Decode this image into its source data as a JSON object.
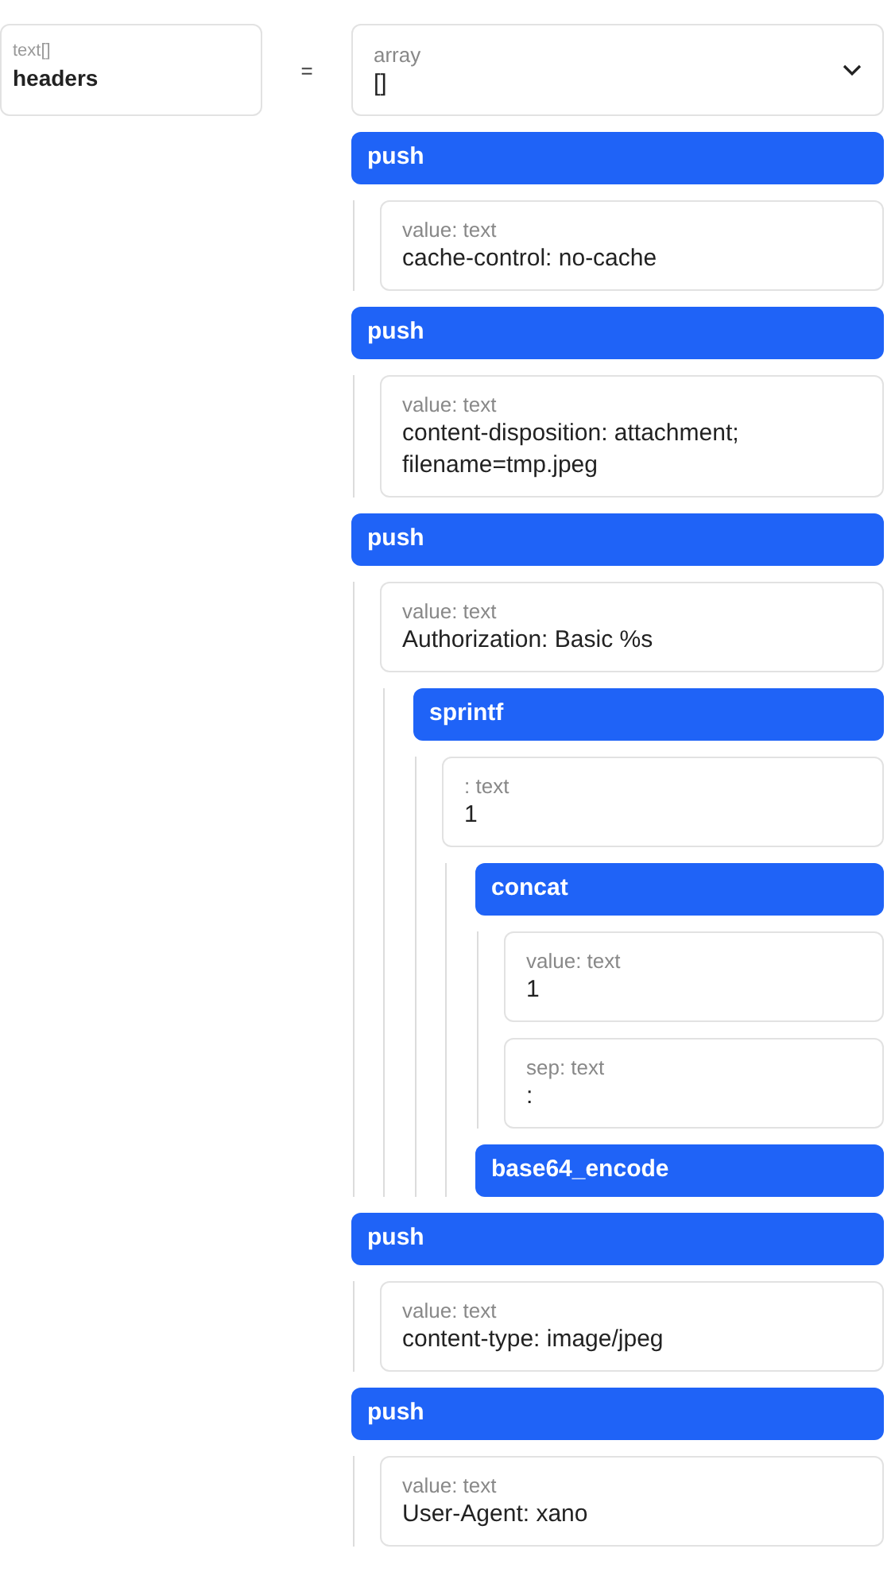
{
  "variable": {
    "type": "text[]",
    "name": "headers"
  },
  "operator": "=",
  "value": {
    "type": "array",
    "value": "[]"
  },
  "filters": [
    {
      "name": "push",
      "args": [
        {
          "label": "value: text",
          "value": "cache-control: no-cache"
        }
      ]
    },
    {
      "name": "push",
      "args": [
        {
          "label": "value: text",
          "value": "content-disposition: attachment; filename=tmp.jpeg"
        }
      ]
    },
    {
      "name": "push",
      "args": [
        {
          "label": "value: text",
          "value": "Authorization: Basic %s",
          "filters": [
            {
              "name": "sprintf",
              "args": [
                {
                  "label": ": text",
                  "value": "1",
                  "filters": [
                    {
                      "name": "concat",
                      "args": [
                        {
                          "label": "value: text",
                          "value": "1"
                        },
                        {
                          "label": "sep: text",
                          "value": ":"
                        }
                      ]
                    },
                    {
                      "name": "base64_encode"
                    }
                  ]
                }
              ]
            }
          ]
        }
      ]
    },
    {
      "name": "push",
      "args": [
        {
          "label": "value: text",
          "value": "content-type: image/jpeg"
        }
      ]
    },
    {
      "name": "push",
      "args": [
        {
          "label": "value: text",
          "value": "User-Agent: xano"
        }
      ]
    }
  ]
}
